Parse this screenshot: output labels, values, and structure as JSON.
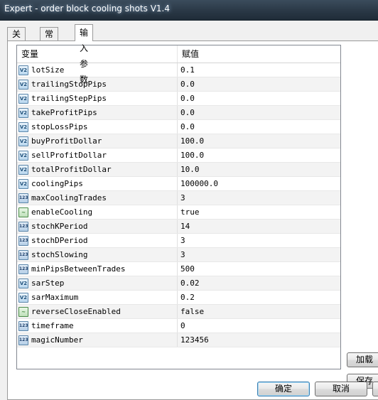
{
  "window": {
    "title": "Expert - order block cooling shots V1.4"
  },
  "tabs": [
    {
      "label": "关于",
      "active": false
    },
    {
      "label": "常用",
      "active": false
    },
    {
      "label": "输入参数",
      "active": true
    }
  ],
  "grid": {
    "headers": {
      "variable": "变量",
      "value": "赋值"
    },
    "rows": [
      {
        "icon": "double",
        "name": "lotSize",
        "value": "0.1"
      },
      {
        "icon": "double",
        "name": "trailingStopPips",
        "value": "0.0"
      },
      {
        "icon": "double",
        "name": "trailingStepPips",
        "value": "0.0"
      },
      {
        "icon": "double",
        "name": "takeProfitPips",
        "value": "0.0"
      },
      {
        "icon": "double",
        "name": "stopLossPips",
        "value": "0.0"
      },
      {
        "icon": "double",
        "name": "buyProfitDollar",
        "value": "100.0"
      },
      {
        "icon": "double",
        "name": "sellProfitDollar",
        "value": "100.0"
      },
      {
        "icon": "double",
        "name": "totalProfitDollar",
        "value": "10.0"
      },
      {
        "icon": "double",
        "name": "coolingPips",
        "value": "100000.0"
      },
      {
        "icon": "int",
        "name": "maxCoolingTrades",
        "value": "3"
      },
      {
        "icon": "bool",
        "name": "enableCooling",
        "value": "true"
      },
      {
        "icon": "int",
        "name": "stochKPeriod",
        "value": "14"
      },
      {
        "icon": "int",
        "name": "stochDPeriod",
        "value": "3"
      },
      {
        "icon": "int",
        "name": "stochSlowing",
        "value": "3"
      },
      {
        "icon": "int",
        "name": "minPipsBetweenTrades",
        "value": "500"
      },
      {
        "icon": "double",
        "name": "sarStep",
        "value": "0.02"
      },
      {
        "icon": "double",
        "name": "sarMaximum",
        "value": "0.2"
      },
      {
        "icon": "bool",
        "name": "reverseCloseEnabled",
        "value": "false"
      },
      {
        "icon": "int",
        "name": "timeframe",
        "value": "0"
      },
      {
        "icon": "int",
        "name": "magicNumber",
        "value": "123456"
      }
    ]
  },
  "icon_glyphs": {
    "double": "V2",
    "int": "123",
    "bool": "~"
  },
  "side_buttons": {
    "load": "加载",
    "save": "保存"
  },
  "footer": {
    "ok": "确定",
    "cancel": "取消"
  }
}
